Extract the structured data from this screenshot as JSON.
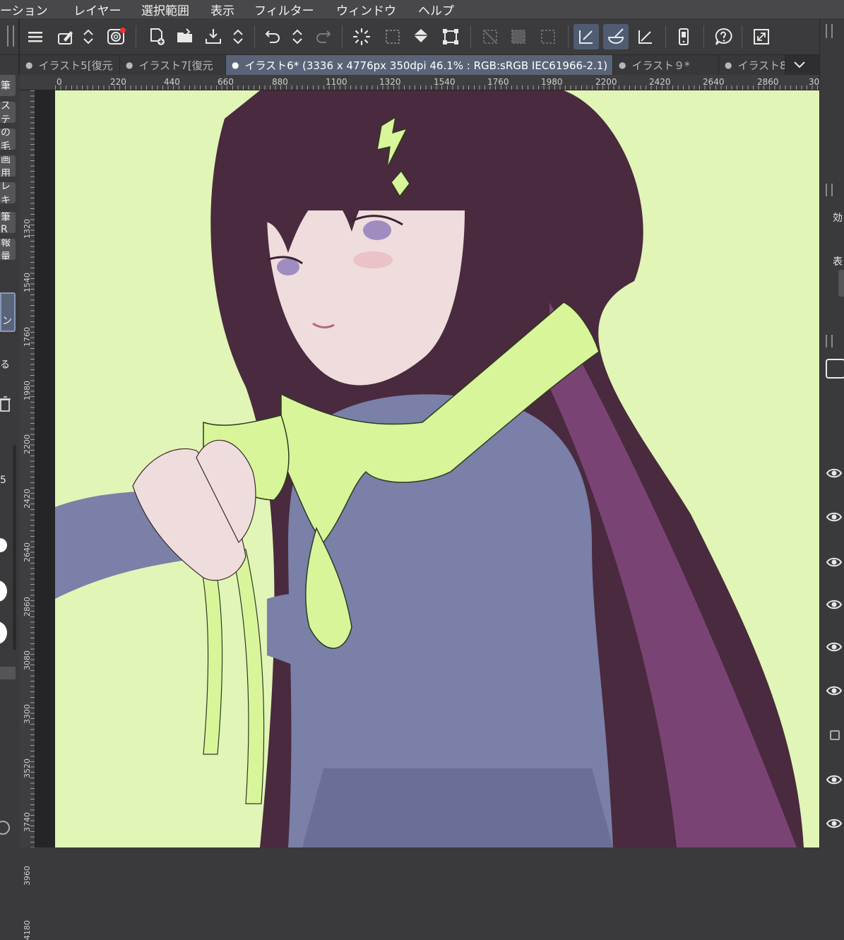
{
  "menu": {
    "items": [
      "ーション",
      "レイヤー",
      "選択範囲",
      "表示",
      "フィルター",
      "ウィンドウ",
      "ヘルプ"
    ]
  },
  "toolbar": {
    "icons": [
      "menu-icon",
      "brush-edit-icon",
      "up-down-icon",
      "spiral-app-icon",
      "new-canvas-icon",
      "open-folder-icon",
      "save-icon",
      "up-down-icon",
      "undo-icon",
      "up-down-icon",
      "redo-icon",
      "loading-spinner-icon",
      "selection-icon",
      "fill-icon",
      "transform-icon",
      "hide-selection-icon",
      "fill-selection-icon",
      "clear-selection-icon",
      "pen-ruler-icon",
      "brush-bowl-icon",
      "ruler-icon",
      "smartphone-icon",
      "help-icon",
      "expand-icon"
    ]
  },
  "tabs": [
    {
      "label": "イラスト5[復元",
      "active": false
    },
    {
      "label": "イラスト7[復元",
      "active": false
    },
    {
      "label": "イラスト6* (3336 x 4776px 350dpi 46.1% : RGB:sRGB IEC61966-2.1)",
      "active": true
    },
    {
      "label": "イラスト９*",
      "active": false
    },
    {
      "label": "イラスト8",
      "active": false
    }
  ],
  "ruler": {
    "top": [
      "0",
      "220",
      "440",
      "660",
      "880",
      "1100",
      "1320",
      "1540",
      "1760",
      "1980",
      "2200",
      "2420",
      "2640",
      "2860",
      "30"
    ],
    "left": [
      "1320",
      "1540",
      "1760",
      "1980",
      "2200",
      "2420",
      "2640",
      "2860",
      "3080",
      "3300",
      "3520",
      "3740",
      "3960",
      "4180"
    ]
  },
  "left_panel": {
    "labels": [
      "筆",
      "ステ",
      "の毛",
      "画用",
      "レキ",
      "筆R",
      "報量",
      "ン",
      "る",
      "5"
    ]
  },
  "right_panel": {
    "labels": [
      "効",
      "表"
    ]
  },
  "colors": {
    "canvas_bg": "#e0f5b6",
    "hair": "#4a2a3e",
    "uniform": "#7a80a8",
    "scarf": "#d8f59a",
    "skin": "#efdcdc"
  }
}
